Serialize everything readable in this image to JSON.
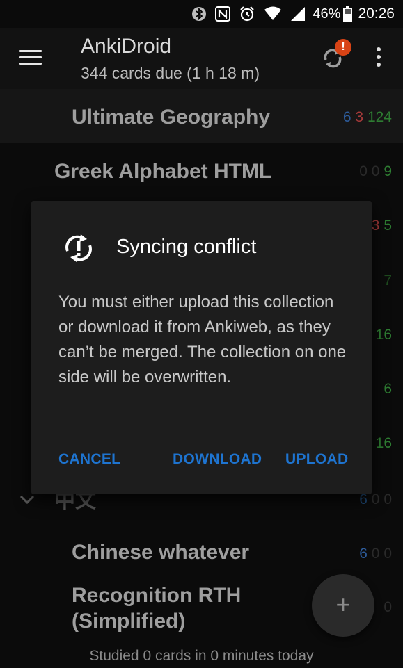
{
  "status_bar": {
    "battery_percent": "46%",
    "time": "20:26",
    "icons": [
      "bluetooth-icon",
      "nfc-icon",
      "alarm-icon",
      "wifi-icon",
      "signal-icon",
      "battery-icon"
    ]
  },
  "toolbar": {
    "title": "AnkiDroid",
    "subtitle": "344 cards due (1 h 18 m)",
    "sync_badge": "!"
  },
  "decks": [
    {
      "name": "Ultimate Geography",
      "counts": [
        "6",
        "3",
        "124"
      ]
    },
    {
      "name": "Greek Alphabet HTML",
      "counts": [
        "0",
        "0",
        "9"
      ]
    },
    {
      "name": "",
      "counts": [
        "",
        "3",
        "5"
      ]
    },
    {
      "name": "",
      "counts": [
        "",
        "",
        "7"
      ]
    },
    {
      "name": "",
      "counts": [
        "",
        "",
        "16"
      ]
    },
    {
      "name": "",
      "counts": [
        "",
        "",
        "6"
      ]
    },
    {
      "name": "",
      "counts": [
        "",
        "",
        "16"
      ]
    },
    {
      "name": "中文",
      "counts": [
        "6",
        "0",
        "0"
      ]
    },
    {
      "name": "Chinese whatever",
      "counts": [
        "6",
        "0",
        "0"
      ]
    },
    {
      "name": "Recognition RTH (Simplified)",
      "name_line1": "Recognition RTH",
      "name_line2": "(Simplified)",
      "counts": [
        "",
        "",
        "0"
      ]
    }
  ],
  "studied_text": "Studied 0 cards in 0 minutes today",
  "fab_label": "+",
  "dialog": {
    "title": "Syncing conflict",
    "body": "You must either upload this collection or download it from Ankiweb, as they can’t be merged. The collection on one side will be overwritten.",
    "buttons": {
      "cancel": "CANCEL",
      "download": "DOWNLOAD",
      "upload": "UPLOAD"
    }
  },
  "colors": {
    "accent": "#1e74d0",
    "badge": "#d84315",
    "new_count": "#2d5b9a",
    "learn_count": "#a63a3a",
    "review_count": "#2e7d32"
  }
}
